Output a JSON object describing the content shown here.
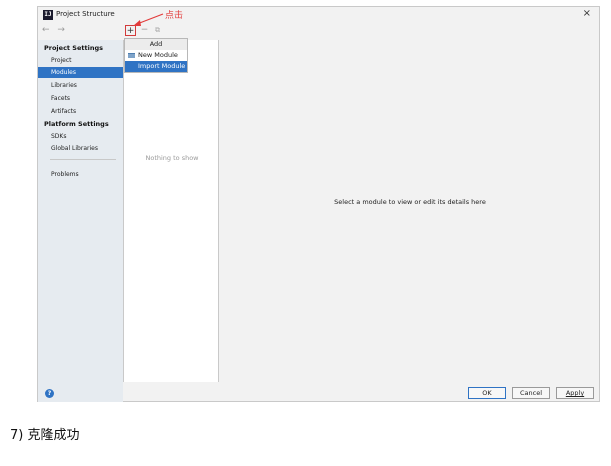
{
  "window": {
    "title": "Project Structure",
    "icon_text": "IJ",
    "close_glyph": "×"
  },
  "nav": {
    "back": "←",
    "forward": "→"
  },
  "sidebar": {
    "project_settings_title": "Project Settings",
    "project_items": [
      "Project",
      "Modules",
      "Libraries",
      "Facets",
      "Artifacts"
    ],
    "selected_item": "Modules",
    "platform_settings_title": "Platform Settings",
    "platform_items": [
      "SDKs",
      "Global Libraries"
    ],
    "problems": "Problems"
  },
  "toolbar": {
    "add": "+",
    "remove": "−",
    "copy": "⧉"
  },
  "module_list": {
    "empty_text": "Nothing to show"
  },
  "popup": {
    "header": "Add",
    "items": [
      "New Module",
      "Import Module"
    ],
    "selected": "Import Module"
  },
  "detail": {
    "message": "Select a module to view or edit its details here"
  },
  "footer": {
    "help": "?",
    "ok": "OK",
    "cancel": "Cancel",
    "apply": "Apply"
  },
  "annotation": {
    "text": "点击",
    "color": "#e23b3b"
  },
  "step_text": "7)   克隆成功",
  "colors": {
    "selection": "#2f73c4",
    "sidebar_bg": "#e6ebf0"
  }
}
